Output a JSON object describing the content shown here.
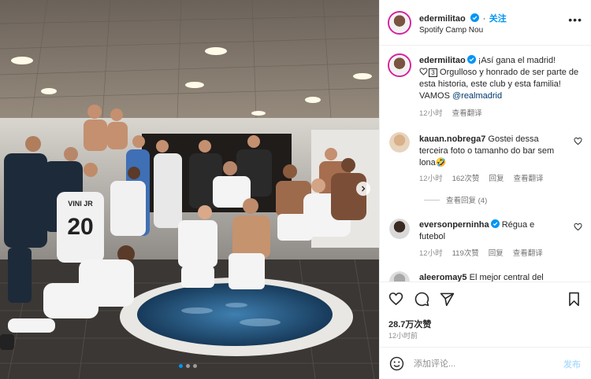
{
  "post": {
    "username": "edermilitao",
    "follow_label": "关注",
    "location": "Spotify Camp Nou",
    "more_label": "•••",
    "carousel_dots": 3
  },
  "caption": {
    "username": "edermilitao",
    "text_main": " ¡Así gana el madrid!",
    "badge_count": "3",
    "text_rest": " Orgulloso y honrado de ser parte de esta historia, este club y esta familia! VAMOS ",
    "mention": "@realmadrid",
    "time": "12小时",
    "translate": "查看翻译"
  },
  "comments": [
    {
      "username": "kauan.nobrega7",
      "text": " Gostei dessa terceira foto o tamanho do bar sem lona🤣",
      "time": "12小时",
      "likes": "",
      "reply": "回复",
      "translate": "查看翻译",
      "view_replies": "查看回复 (4)"
    },
    {
      "username": "eversonperninha",
      "text": " Régua e futebol",
      "time": "12小时",
      "likes": "119次赞",
      "reply": "回复",
      "translate": "查看翻译"
    },
    {
      "username": "aleeromay5",
      "text": " El mejor central del"
    }
  ],
  "comment1_likes": "162次赞",
  "stats": {
    "likes": "28.7万次赞",
    "time": "12小时前"
  },
  "add_comment": {
    "placeholder": "添加评论...",
    "post_label": "发布"
  },
  "jersey": {
    "name": "VINI JR",
    "number": "20"
  },
  "colors": {
    "accent": "#0095f6",
    "verified": "#0095f6",
    "ring": "#d6249f",
    "muted": "#8e8e8e"
  },
  "icons": [
    "heart-icon",
    "comment-icon",
    "share-icon",
    "bookmark-icon",
    "emoji-icon",
    "verified-icon",
    "chevron-right-icon",
    "more-icon"
  ]
}
